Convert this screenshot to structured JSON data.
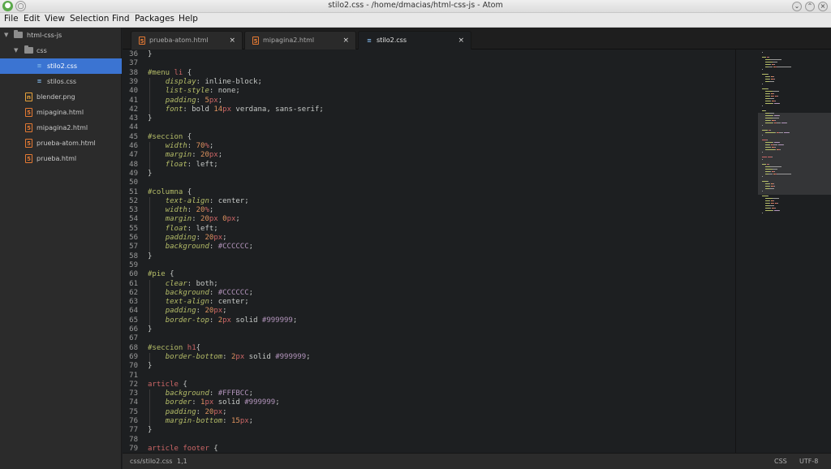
{
  "window": {
    "title": "stilo2.css - /home/dmacias/html-css-js - Atom",
    "buttons": [
      "minimize-icon",
      "maximize-icon",
      "close-icon"
    ]
  },
  "menu": [
    "File",
    "Edit",
    "View",
    "Selection",
    "Find",
    "Packages",
    "Help"
  ],
  "sidebar": {
    "items": [
      {
        "label": "html-css-js",
        "type": "folder",
        "expanded": true,
        "depth": 0
      },
      {
        "label": "css",
        "type": "folder",
        "expanded": true,
        "depth": 1
      },
      {
        "label": "stilo2.css",
        "type": "css",
        "depth": 2,
        "selected": true
      },
      {
        "label": "stilos.css",
        "type": "css",
        "depth": 2
      },
      {
        "label": "blender.png",
        "type": "image",
        "depth": 1
      },
      {
        "label": "mipagina.html",
        "type": "html",
        "depth": 1
      },
      {
        "label": "mipagina2.html",
        "type": "html",
        "depth": 1
      },
      {
        "label": "prueba-atom.html",
        "type": "html",
        "depth": 1
      },
      {
        "label": "prueba.html",
        "type": "html",
        "depth": 1
      }
    ]
  },
  "tabs": [
    {
      "label": "prueba-atom.html",
      "type": "html",
      "active": false
    },
    {
      "label": "mipagina2.html",
      "type": "html",
      "active": false
    },
    {
      "label": "stilo2.css",
      "type": "css",
      "active": true
    }
  ],
  "editor": {
    "first_line": 36,
    "lines": [
      [
        [
          "}",
          "punct"
        ]
      ],
      [],
      [
        [
          "#menu",
          "sel"
        ],
        [
          " ",
          "val"
        ],
        [
          "li",
          "tag"
        ],
        [
          " {",
          "punct"
        ]
      ],
      [
        [
          "    ",
          "val"
        ],
        [
          "display",
          "prop"
        ],
        [
          ": inline-block;",
          "val"
        ]
      ],
      [
        [
          "    ",
          "val"
        ],
        [
          "list-style",
          "prop"
        ],
        [
          ": none;",
          "val"
        ]
      ],
      [
        [
          "    ",
          "val"
        ],
        [
          "padding",
          "prop"
        ],
        [
          ": ",
          "val"
        ],
        [
          "5",
          "num"
        ],
        [
          "px",
          "unit"
        ],
        [
          ";",
          "val"
        ]
      ],
      [
        [
          "    ",
          "val"
        ],
        [
          "font",
          "prop"
        ],
        [
          ": bold ",
          "val"
        ],
        [
          "14",
          "num"
        ],
        [
          "px",
          "unit"
        ],
        [
          " verdana, sans-serif;",
          "val"
        ]
      ],
      [
        [
          "}",
          "punct"
        ]
      ],
      [],
      [
        [
          "#seccion",
          "sel"
        ],
        [
          " {",
          "punct"
        ]
      ],
      [
        [
          "    ",
          "val"
        ],
        [
          "width",
          "prop"
        ],
        [
          ": ",
          "val"
        ],
        [
          "70",
          "num"
        ],
        [
          "%",
          "unit"
        ],
        [
          ";",
          "val"
        ]
      ],
      [
        [
          "    ",
          "val"
        ],
        [
          "margin",
          "prop"
        ],
        [
          ": ",
          "val"
        ],
        [
          "20",
          "num"
        ],
        [
          "px",
          "unit"
        ],
        [
          ";",
          "val"
        ]
      ],
      [
        [
          "    ",
          "val"
        ],
        [
          "float",
          "prop"
        ],
        [
          ": left;",
          "val"
        ]
      ],
      [
        [
          "}",
          "punct"
        ]
      ],
      [],
      [
        [
          "#columna",
          "sel"
        ],
        [
          " {",
          "punct"
        ]
      ],
      [
        [
          "    ",
          "val"
        ],
        [
          "text-align",
          "prop"
        ],
        [
          ": center;",
          "val"
        ]
      ],
      [
        [
          "    ",
          "val"
        ],
        [
          "width",
          "prop"
        ],
        [
          ": ",
          "val"
        ],
        [
          "20",
          "num"
        ],
        [
          "%",
          "unit"
        ],
        [
          ";",
          "val"
        ]
      ],
      [
        [
          "    ",
          "val"
        ],
        [
          "margin",
          "prop"
        ],
        [
          ": ",
          "val"
        ],
        [
          "20",
          "num"
        ],
        [
          "px",
          "unit"
        ],
        [
          " ",
          "val"
        ],
        [
          "0",
          "num"
        ],
        [
          "px",
          "unit"
        ],
        [
          ";",
          "val"
        ]
      ],
      [
        [
          "    ",
          "val"
        ],
        [
          "float",
          "prop"
        ],
        [
          ": left;",
          "val"
        ]
      ],
      [
        [
          "    ",
          "val"
        ],
        [
          "padding",
          "prop"
        ],
        [
          ": ",
          "val"
        ],
        [
          "20",
          "num"
        ],
        [
          "px",
          "unit"
        ],
        [
          ";",
          "val"
        ]
      ],
      [
        [
          "    ",
          "val"
        ],
        [
          "background",
          "prop"
        ],
        [
          ": ",
          "val"
        ],
        [
          "#CCCCCC",
          "hex"
        ],
        [
          ";",
          "val"
        ]
      ],
      [
        [
          "}",
          "punct"
        ]
      ],
      [],
      [
        [
          "#pie",
          "sel"
        ],
        [
          " {",
          "punct"
        ]
      ],
      [
        [
          "    ",
          "val"
        ],
        [
          "clear",
          "prop"
        ],
        [
          ": both;",
          "val"
        ]
      ],
      [
        [
          "    ",
          "val"
        ],
        [
          "background",
          "prop"
        ],
        [
          ": ",
          "val"
        ],
        [
          "#CCCCCC",
          "hex"
        ],
        [
          ";",
          "val"
        ]
      ],
      [
        [
          "    ",
          "val"
        ],
        [
          "text-align",
          "prop"
        ],
        [
          ": center;",
          "val"
        ]
      ],
      [
        [
          "    ",
          "val"
        ],
        [
          "padding",
          "prop"
        ],
        [
          ": ",
          "val"
        ],
        [
          "20",
          "num"
        ],
        [
          "px",
          "unit"
        ],
        [
          ";",
          "val"
        ]
      ],
      [
        [
          "    ",
          "val"
        ],
        [
          "border-top",
          "prop"
        ],
        [
          ": ",
          "val"
        ],
        [
          "2",
          "num"
        ],
        [
          "px",
          "unit"
        ],
        [
          " solid ",
          "val"
        ],
        [
          "#999999",
          "hex"
        ],
        [
          ";",
          "val"
        ]
      ],
      [
        [
          "}",
          "punct"
        ]
      ],
      [],
      [
        [
          "#seccion",
          "sel"
        ],
        [
          " ",
          "val"
        ],
        [
          "h1",
          "tag"
        ],
        [
          "{",
          "punct"
        ]
      ],
      [
        [
          "    ",
          "val"
        ],
        [
          "border-bottom",
          "prop"
        ],
        [
          ": ",
          "val"
        ],
        [
          "2",
          "num"
        ],
        [
          "px",
          "unit"
        ],
        [
          " solid ",
          "val"
        ],
        [
          "#999999",
          "hex"
        ],
        [
          ";",
          "val"
        ]
      ],
      [
        [
          "}",
          "punct"
        ]
      ],
      [],
      [
        [
          "article",
          "tag"
        ],
        [
          " {",
          "punct"
        ]
      ],
      [
        [
          "    ",
          "val"
        ],
        [
          "background",
          "prop"
        ],
        [
          ": ",
          "val"
        ],
        [
          "#FFFBCC",
          "hex"
        ],
        [
          ";",
          "val"
        ]
      ],
      [
        [
          "    ",
          "val"
        ],
        [
          "border",
          "prop"
        ],
        [
          ": ",
          "val"
        ],
        [
          "1",
          "num"
        ],
        [
          "px",
          "unit"
        ],
        [
          " solid ",
          "val"
        ],
        [
          "#999999",
          "hex"
        ],
        [
          ";",
          "val"
        ]
      ],
      [
        [
          "    ",
          "val"
        ],
        [
          "padding",
          "prop"
        ],
        [
          ": ",
          "val"
        ],
        [
          "20",
          "num"
        ],
        [
          "px",
          "unit"
        ],
        [
          ";",
          "val"
        ]
      ],
      [
        [
          "    ",
          "val"
        ],
        [
          "margin-bottom",
          "prop"
        ],
        [
          ": ",
          "val"
        ],
        [
          "15",
          "num"
        ],
        [
          "px",
          "unit"
        ],
        [
          ";",
          "val"
        ]
      ],
      [
        [
          "}",
          "punct"
        ]
      ],
      [],
      [
        [
          "article",
          "tag"
        ],
        [
          " ",
          "val"
        ],
        [
          "footer",
          "tag"
        ],
        [
          " {",
          "punct"
        ]
      ]
    ]
  },
  "status": {
    "path": "css/stilo2.css",
    "cursor": "1,1",
    "grammar": "CSS",
    "encoding": "UTF-8"
  },
  "colors": {
    "accent": "#3b74d2",
    "selector": "#b5bd68",
    "tag": "#cc6666",
    "number": "#de935f",
    "hex": "#b294bb"
  }
}
